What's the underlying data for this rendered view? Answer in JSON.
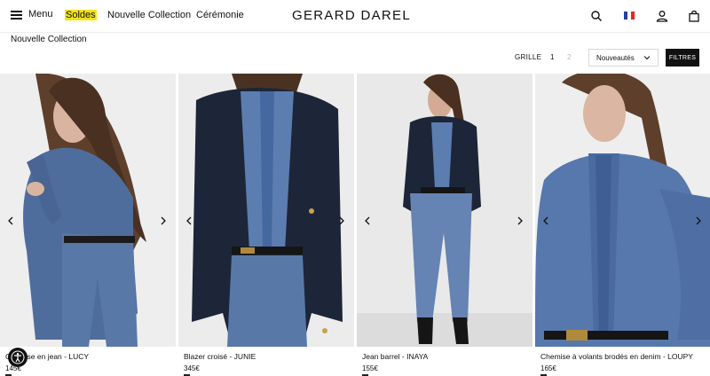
{
  "header": {
    "menu_label": "Menu",
    "nav": [
      "Soldes",
      "Nouvelle Collection",
      "Cérémonie"
    ],
    "logo": "GERARD DAREL",
    "icons": [
      "search-icon",
      "flag-fr-icon",
      "user-icon",
      "bag-icon"
    ],
    "highlight_color": "#f3e316"
  },
  "page": {
    "title": "Nouvelle Collection"
  },
  "toolbar": {
    "grid_label": "GRILLE",
    "grid_options": [
      "1",
      "2"
    ],
    "sort_value": "Nouveautés",
    "filters_label": "FILTRES"
  },
  "products": [
    {
      "name": "Chemise en jean - LUCY",
      "price": "145€",
      "image": "woman in denim shirt and jeans"
    },
    {
      "name": "Blazer croisé - JUNIE",
      "price": "345€",
      "image": "navy double-breasted blazer over ruffled denim shirt"
    },
    {
      "name": "Jean barrel - INAYA",
      "price": "155€",
      "image": "barrel jeans with navy blazer and boots"
    },
    {
      "name": "Chemise à volants brodés en denim - LOUPY",
      "price": "165€",
      "image": "denim shirt with embroidered ruffle"
    }
  ]
}
